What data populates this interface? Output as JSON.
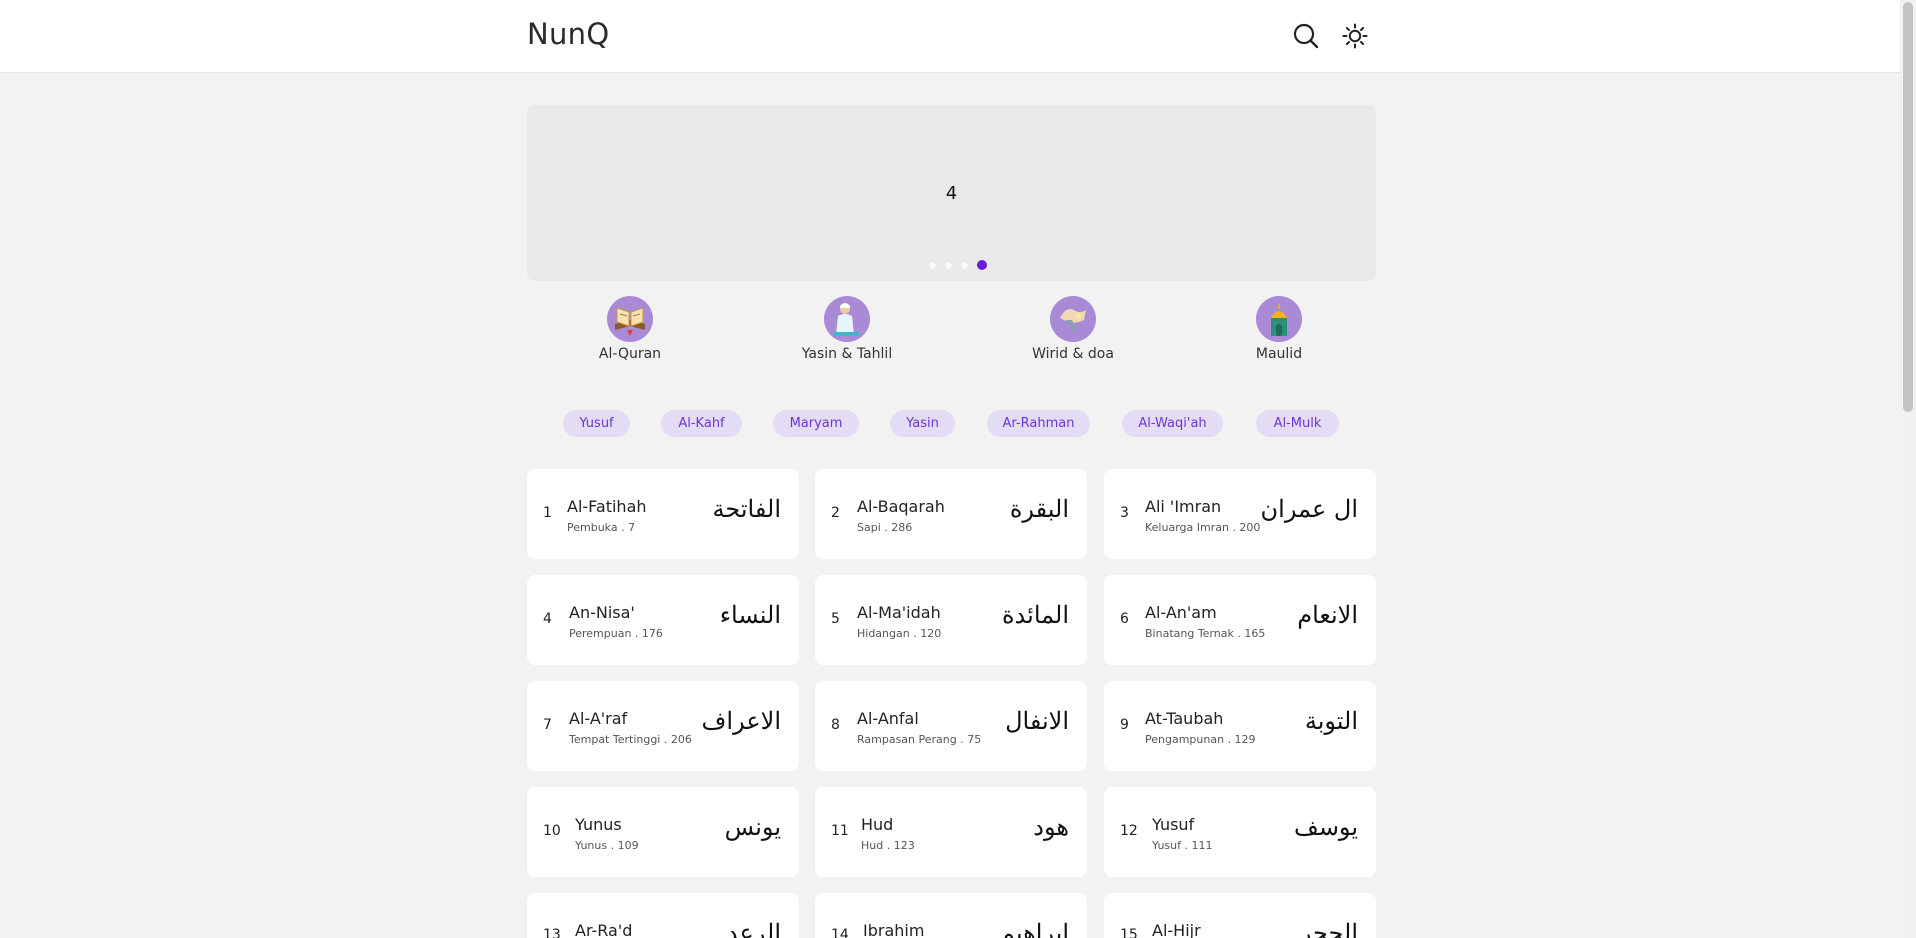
{
  "header": {
    "title": "NunQ",
    "search_icon": "search-icon",
    "theme_icon": "sun-icon"
  },
  "carousel": {
    "current_slide": "4",
    "slide_count": 4,
    "active_index": 4,
    "active_color": "#6a1bd6"
  },
  "menu": [
    {
      "label": "Al-Quran",
      "icon": "quran-book-icon"
    },
    {
      "label": "Yasin & Tahlil",
      "icon": "praying-person-icon"
    },
    {
      "label": "Wirid & doa",
      "icon": "prayer-hands-icon"
    },
    {
      "label": "Maulid",
      "icon": "mosque-icon"
    }
  ],
  "quick_links": [
    "Yusuf",
    "Al-Kahf",
    "Maryam",
    "Yasin",
    "Ar-Rahman",
    "Al-Waqi'ah",
    "Al-Mulk"
  ],
  "surahs": [
    {
      "number": "1",
      "name": "Al-Fatihah",
      "meaning": "Pembuka . 7",
      "arabic": "الفاتحة"
    },
    {
      "number": "2",
      "name": "Al-Baqarah",
      "meaning": "Sapi . 286",
      "arabic": "البقرة"
    },
    {
      "number": "3",
      "name": "Ali 'Imran",
      "meaning": "Keluarga Imran . 200",
      "arabic": "ال عمران"
    },
    {
      "number": "4",
      "name": "An-Nisa'",
      "meaning": "Perempuan . 176",
      "arabic": "النساء"
    },
    {
      "number": "5",
      "name": "Al-Ma'idah",
      "meaning": "Hidangan . 120",
      "arabic": "المائدة"
    },
    {
      "number": "6",
      "name": "Al-An'am",
      "meaning": "Binatang Ternak . 165",
      "arabic": "الانعام"
    },
    {
      "number": "7",
      "name": "Al-A'raf",
      "meaning": "Tempat Tertinggi . 206",
      "arabic": "الاعراف"
    },
    {
      "number": "8",
      "name": "Al-Anfal",
      "meaning": "Rampasan Perang . 75",
      "arabic": "الانفال"
    },
    {
      "number": "9",
      "name": "At-Taubah",
      "meaning": "Pengampunan . 129",
      "arabic": "التوبة"
    },
    {
      "number": "10",
      "name": "Yunus",
      "meaning": "Yunus . 109",
      "arabic": "يونس"
    },
    {
      "number": "11",
      "name": "Hud",
      "meaning": "Hud . 123",
      "arabic": "هود"
    },
    {
      "number": "12",
      "name": "Yusuf",
      "meaning": "Yusuf . 111",
      "arabic": "يوسف"
    },
    {
      "number": "13",
      "name": "Ar-Ra'd",
      "meaning": "",
      "arabic": "الرعد"
    },
    {
      "number": "14",
      "name": "Ibrahim",
      "meaning": "",
      "arabic": "ابراهيم"
    },
    {
      "number": "15",
      "name": "Al-Hijr",
      "meaning": "",
      "arabic": "الحجر"
    }
  ]
}
